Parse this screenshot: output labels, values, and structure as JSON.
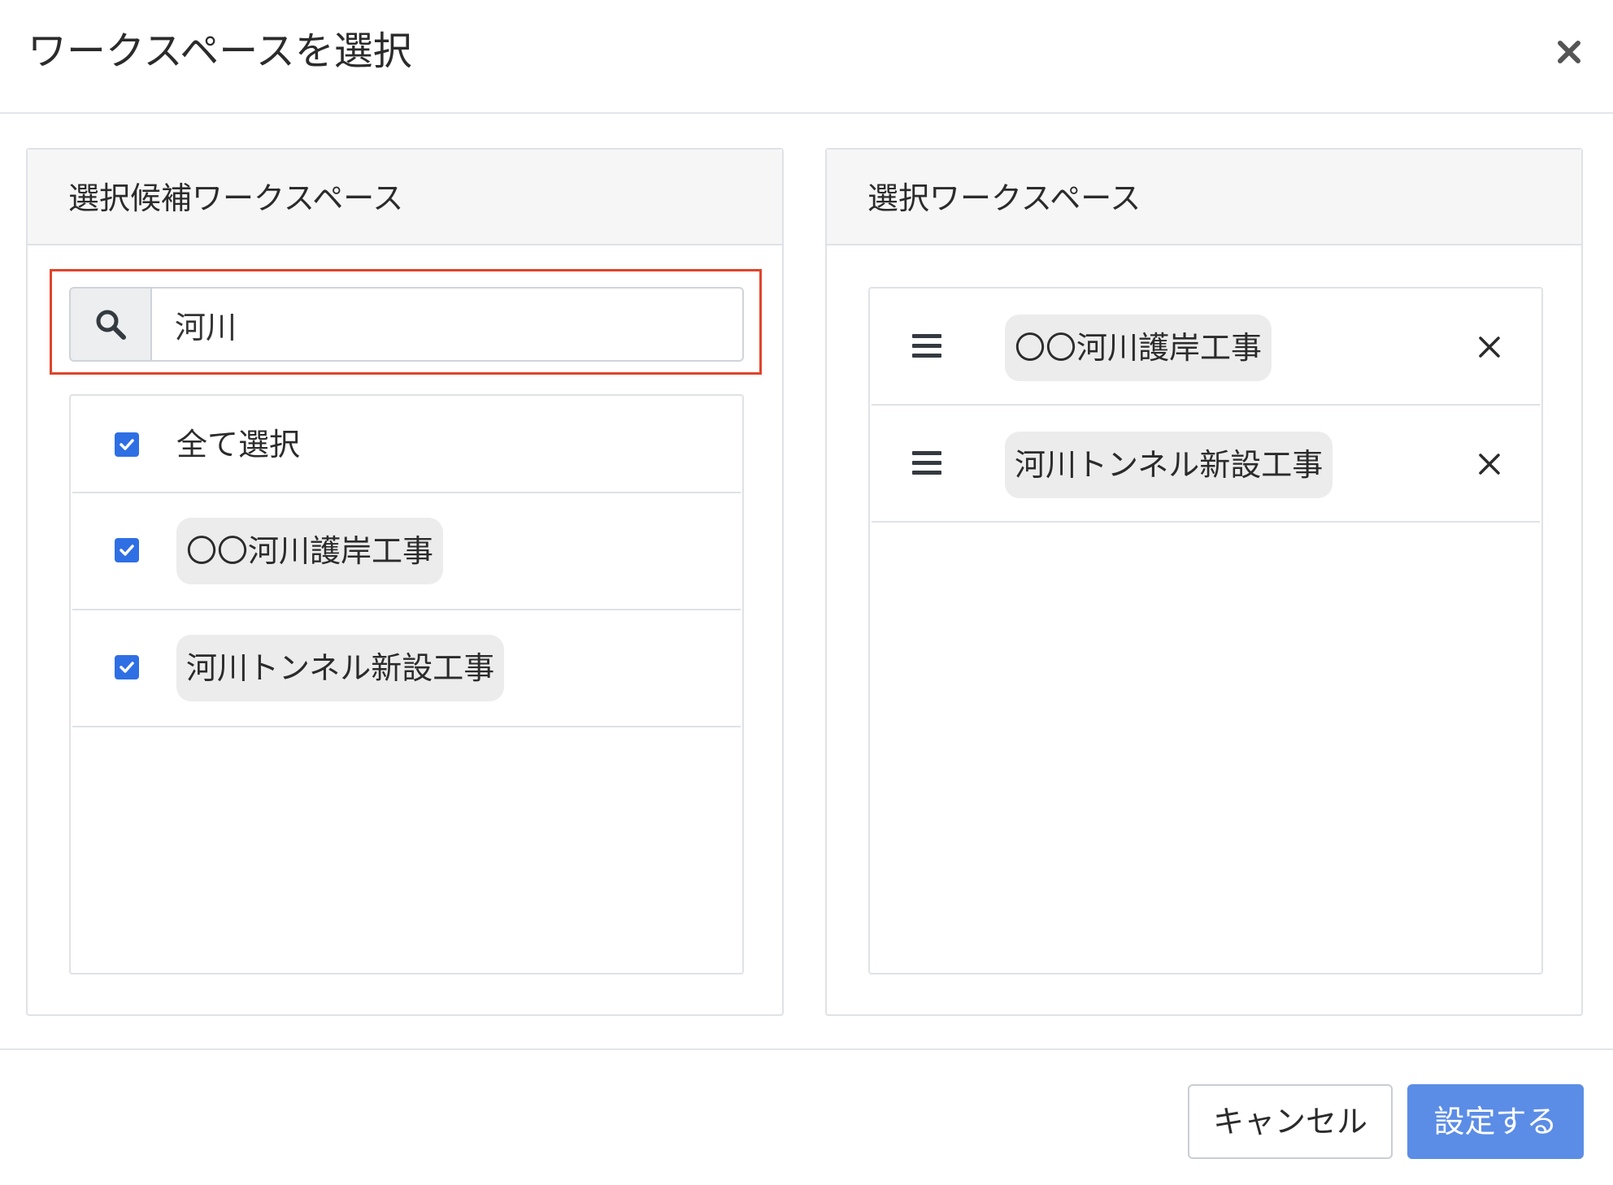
{
  "dialog": {
    "title": "ワークスペースを選択",
    "close_icon": "close-icon"
  },
  "candidates_panel": {
    "title": "選択候補ワークスペース",
    "search": {
      "icon": "search-icon",
      "value": "河川",
      "placeholder": ""
    },
    "select_all": {
      "label": "全て選択",
      "checked": true
    },
    "items": [
      {
        "label": "〇〇河川護岸工事",
        "checked": true
      },
      {
        "label": "河川トンネル新設工事",
        "checked": true
      }
    ]
  },
  "selected_panel": {
    "title": "選択ワークスペース",
    "items": [
      {
        "label": "〇〇河川護岸工事",
        "handle_icon": "drag-handle-icon",
        "remove_icon": "remove-icon"
      },
      {
        "label": "河川トンネル新設工事",
        "handle_icon": "drag-handle-icon",
        "remove_icon": "remove-icon"
      }
    ]
  },
  "footer": {
    "cancel_label": "キャンセル",
    "submit_label": "設定する"
  },
  "colors": {
    "primary": "#5b8de6",
    "checkbox": "#2f6fe4",
    "highlight": "#e0442b",
    "chip_bg": "#ececec",
    "panel_header_bg": "#f6f6f6"
  }
}
